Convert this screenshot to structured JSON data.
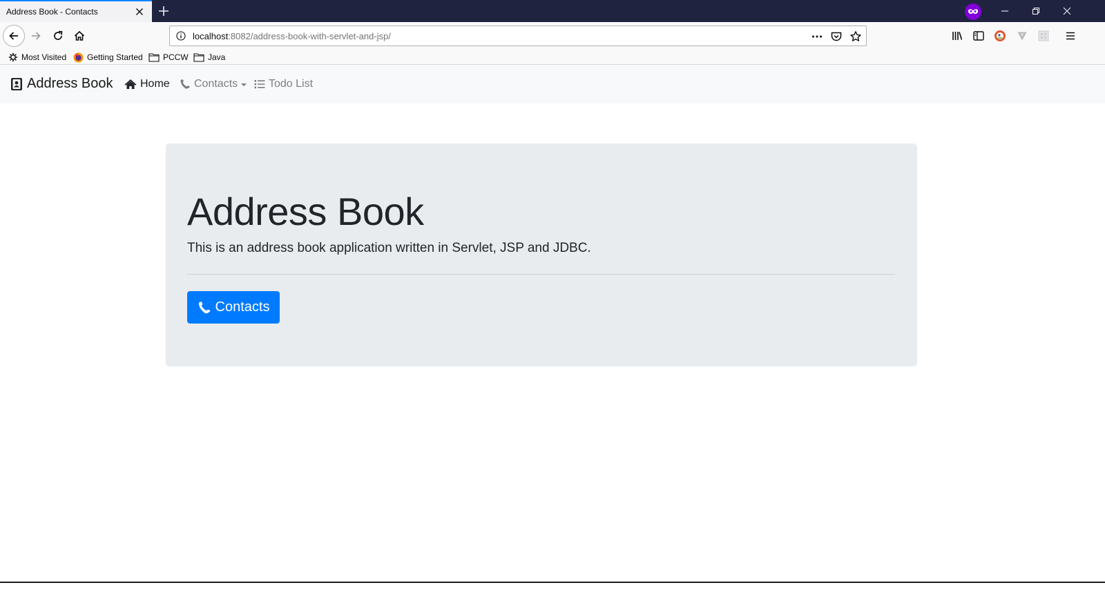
{
  "browser": {
    "tab_title": "Address Book - Contacts",
    "url_host": "localhost",
    "url_rest": ":8082/address-book-with-servlet-and-jsp/",
    "bookmarks": [
      {
        "label": "Most Visited",
        "icon": "gear-icon"
      },
      {
        "label": "Getting Started",
        "icon": "firefox-icon"
      },
      {
        "label": "PCCW",
        "icon": "folder-icon"
      },
      {
        "label": "Java",
        "icon": "folder-icon"
      }
    ],
    "accent_color": "#0a84ff",
    "titlebar_color": "#202340"
  },
  "site_nav": {
    "brand": "Address Book",
    "links": [
      {
        "label": "Home",
        "icon": "home-icon"
      },
      {
        "label": "Contacts",
        "icon": "phone-icon"
      },
      {
        "label": "Todo List",
        "icon": "list-icon"
      }
    ]
  },
  "jumbotron": {
    "title": "Address Book",
    "lead": "This is an address book application written in Servlet, JSP and JDBC.",
    "button_label": "Contacts",
    "button_color": "#007bff"
  }
}
